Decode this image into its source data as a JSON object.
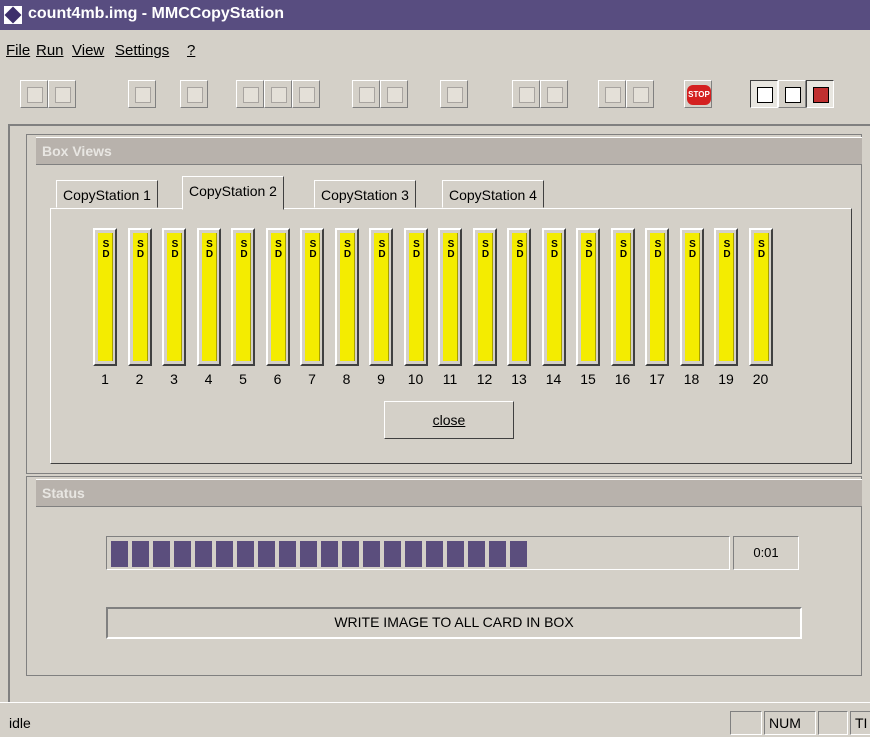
{
  "window": {
    "title": "count4mb.img - MMCCopyStation"
  },
  "menu": {
    "items": [
      {
        "label": "File",
        "accel": "F"
      },
      {
        "label": "Run",
        "accel": "R"
      },
      {
        "label": "View",
        "accel": "V"
      },
      {
        "label": "Settings",
        "accel": "S"
      },
      {
        "label": "?",
        "accel": "?"
      }
    ]
  },
  "toolbar": {
    "stop_label": "STOP"
  },
  "box_views": {
    "title": "Box Views",
    "tabs": [
      "CopyStation 1",
      "CopyStation 2",
      "CopyStation 3",
      "CopyStation 4"
    ],
    "active_tab": "CopyStation 2",
    "slot_label": "SD",
    "slots": [
      "1",
      "2",
      "3",
      "4",
      "5",
      "6",
      "7",
      "8",
      "9",
      "10",
      "11",
      "12",
      "13",
      "14",
      "15",
      "16",
      "17",
      "18",
      "19",
      "20"
    ],
    "close_label": "close"
  },
  "status": {
    "title": "Status",
    "progress_fraction": 0.68,
    "elapsed": "0:01",
    "message": "WRITE IMAGE TO ALL CARD IN BOX"
  },
  "statusbar": {
    "text": "idle",
    "num": "NUM",
    "tail": "TI"
  },
  "colors": {
    "titlebar": "#584d80",
    "progress": "#5b4e7d",
    "card": "#f4ec00",
    "panel_header": "#b8b2ac"
  }
}
